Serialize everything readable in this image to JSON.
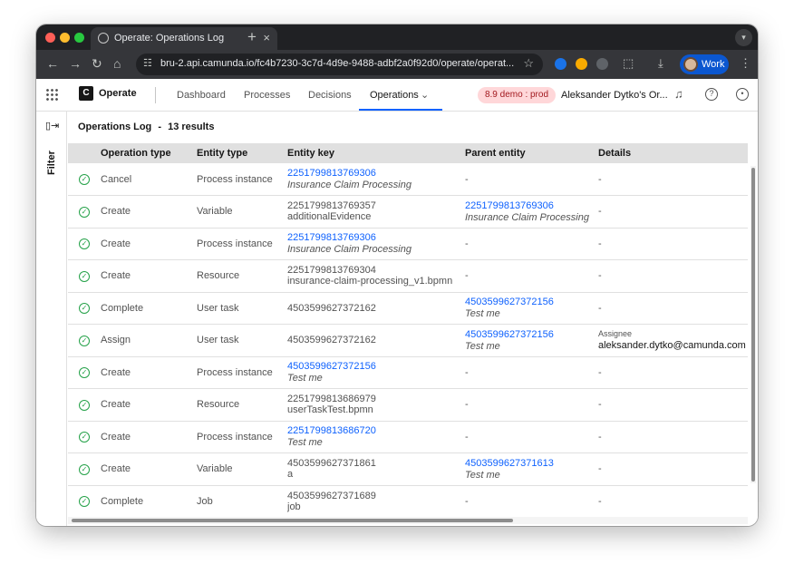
{
  "browser": {
    "tab_title": "Operate: Operations Log",
    "url": "bru-2.api.camunda.io/fc4b7230-3c7d-4d9e-9488-adbf2a0f92d0/operate/operat...",
    "profile_label": "Work"
  },
  "app": {
    "logo_letter": "C",
    "name": "Operate",
    "nav": [
      "Dashboard",
      "Processes",
      "Decisions",
      "Operations"
    ],
    "env_badge": "8.9 demo : prod",
    "org_name": "Aleksander Dytko's Or..."
  },
  "sidebar": {
    "filter_label": "Filter"
  },
  "main": {
    "title": "Operations Log",
    "separator": "-",
    "result_count": "13 results",
    "columns": [
      "Operation type",
      "Entity type",
      "Entity key",
      "Parent entity",
      "Details"
    ],
    "rows": [
      {
        "op": "Cancel",
        "entity_type": "Process instance",
        "key": "2251799813769306",
        "key_sub": "Insurance Claim Processing",
        "key_link": true,
        "parent": "-",
        "parent_sub": "",
        "details_label": "",
        "details": "-"
      },
      {
        "op": "Create",
        "entity_type": "Variable",
        "key": "2251799813769357",
        "key_sub": "additionalEvidence",
        "key_link": false,
        "parent": "2251799813769306",
        "parent_sub": "Insurance Claim Processing",
        "details_label": "",
        "details": "-"
      },
      {
        "op": "Create",
        "entity_type": "Process instance",
        "key": "2251799813769306",
        "key_sub": "Insurance Claim Processing",
        "key_link": true,
        "parent": "-",
        "parent_sub": "",
        "details_label": "",
        "details": "-"
      },
      {
        "op": "Create",
        "entity_type": "Resource",
        "key": "2251799813769304",
        "key_sub": "insurance-claim-processing_v1.bpmn",
        "key_link": false,
        "parent": "-",
        "parent_sub": "",
        "details_label": "",
        "details": "-"
      },
      {
        "op": "Complete",
        "entity_type": "User task",
        "key": "4503599627372162",
        "key_sub": "",
        "key_link": false,
        "parent": "4503599627372156",
        "parent_sub": "Test me",
        "details_label": "",
        "details": "-"
      },
      {
        "op": "Assign",
        "entity_type": "User task",
        "key": "4503599627372162",
        "key_sub": "",
        "key_link": false,
        "parent": "4503599627372156",
        "parent_sub": "Test me",
        "details_label": "Assignee",
        "details": "aleksander.dytko@camunda.com"
      },
      {
        "op": "Create",
        "entity_type": "Process instance",
        "key": "4503599627372156",
        "key_sub": "Test me",
        "key_link": true,
        "parent": "-",
        "parent_sub": "",
        "details_label": "",
        "details": "-"
      },
      {
        "op": "Create",
        "entity_type": "Resource",
        "key": "2251799813686979",
        "key_sub": "userTaskTest.bpmn",
        "key_link": false,
        "parent": "-",
        "parent_sub": "",
        "details_label": "",
        "details": "-"
      },
      {
        "op": "Create",
        "entity_type": "Process instance",
        "key": "2251799813686720",
        "key_sub": "Test me",
        "key_link": true,
        "parent": "-",
        "parent_sub": "",
        "details_label": "",
        "details": "-"
      },
      {
        "op": "Create",
        "entity_type": "Variable",
        "key": "4503599627371861",
        "key_sub": "a",
        "key_link": false,
        "parent": "4503599627371613",
        "parent_sub": "Test me",
        "details_label": "",
        "details": "-"
      },
      {
        "op": "Complete",
        "entity_type": "Job",
        "key": "4503599627371689",
        "key_sub": "job",
        "key_link": false,
        "parent": "-",
        "parent_sub": "",
        "details_label": "",
        "details": "-"
      }
    ]
  },
  "colors": {
    "accent": "#0f62fe",
    "success": "#24a148",
    "env_badge_bg": "#ffd7d9",
    "env_badge_text": "#a2191f"
  }
}
